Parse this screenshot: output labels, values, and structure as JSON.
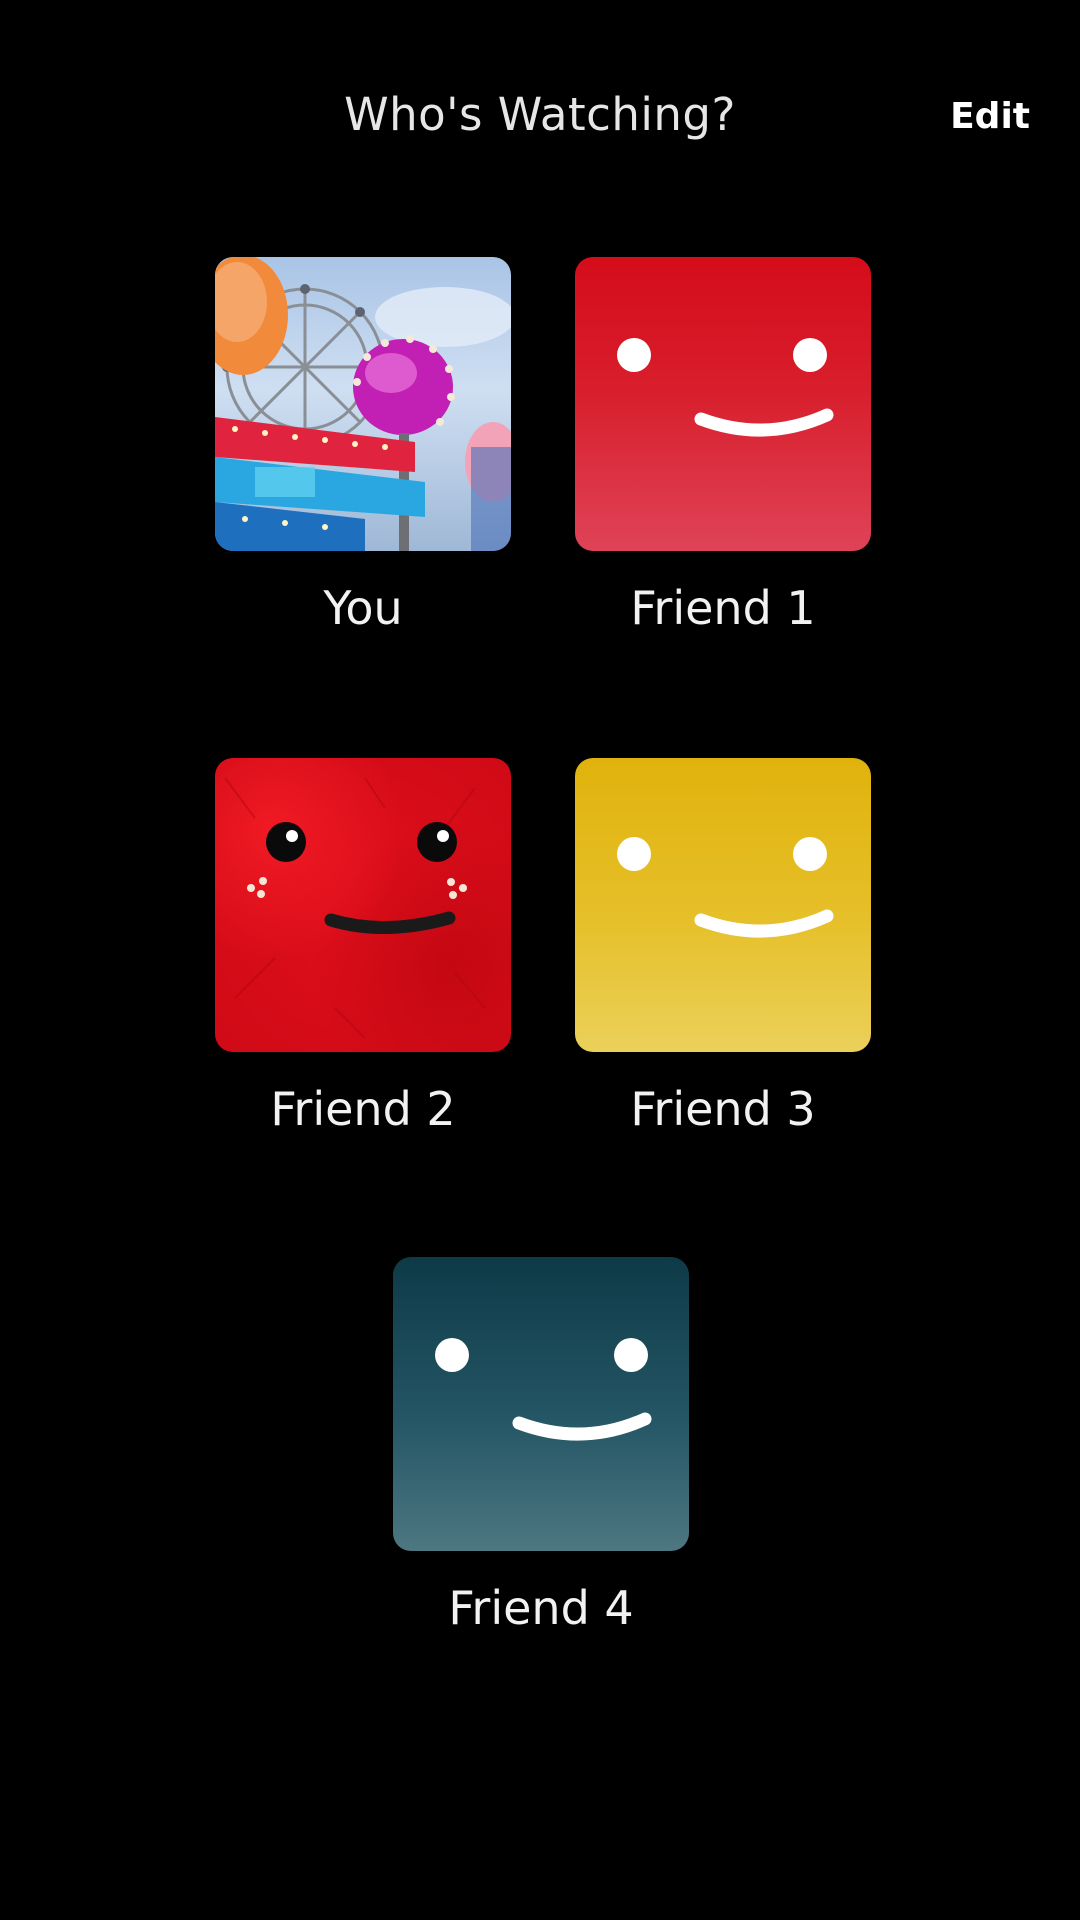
{
  "header": {
    "title": "Who's Watching?",
    "edit_label": "Edit"
  },
  "profiles": [
    {
      "name": "You",
      "avatar": "carnival-photo-avatar"
    },
    {
      "name": "Friend 1",
      "avatar": "red-smiley-avatar",
      "color": "#d50c1a"
    },
    {
      "name": "Friend 2",
      "avatar": "fuzzy-red-smiley-avatar",
      "color": "#e00f1c"
    },
    {
      "name": "Friend 3",
      "avatar": "yellow-smiley-avatar",
      "color": "#e0b20c"
    },
    {
      "name": "Friend 4",
      "avatar": "teal-smiley-avatar",
      "color": "#0e3a47"
    }
  ]
}
